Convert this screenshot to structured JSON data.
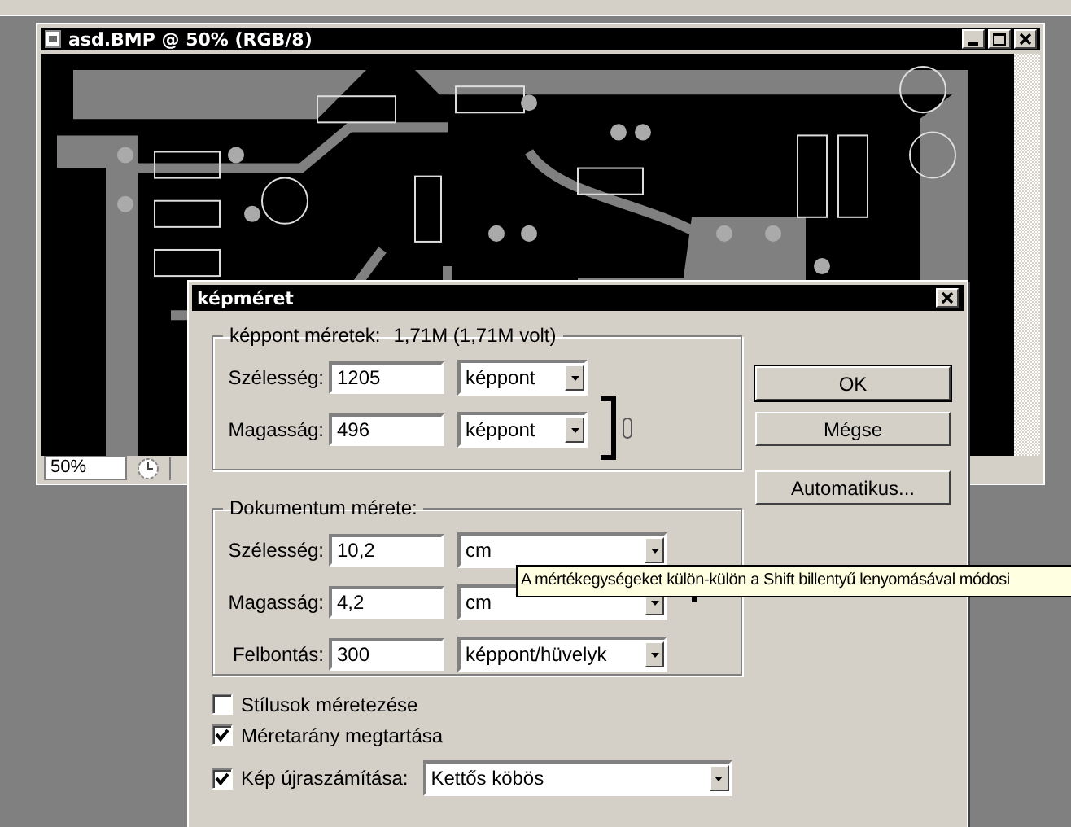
{
  "document": {
    "title": "asd.BMP @ 50% (RGB/8)",
    "zoom": "50%"
  },
  "dialog": {
    "title": "képméret",
    "pixel_group": {
      "label": "képpont méretek:",
      "size": "1,71M (1,71M volt)",
      "fields": [
        {
          "label": "Szélesség:",
          "value": "1205",
          "unit": "képpont"
        },
        {
          "label": "Magasság:",
          "value": "496",
          "unit": "képpont"
        }
      ]
    },
    "document_group": {
      "label": "Dokumentum mérete:",
      "fields": [
        {
          "label": "Szélesség:",
          "value": "10,2",
          "unit": "cm"
        },
        {
          "label": "Magasság:",
          "value": "4,2",
          "unit": "cm"
        },
        {
          "label": "Felbontás:",
          "value": "300",
          "unit": "képpont/hüvelyk"
        }
      ]
    },
    "checkboxes": [
      {
        "label": "Stílusok méretezése",
        "checked": false
      },
      {
        "label": "Méretarány megtartása",
        "checked": true
      }
    ],
    "resample": {
      "label": "Kép újraszámítása:",
      "checked": true,
      "value": "Kettős köbös"
    },
    "buttons": [
      {
        "label": "OK",
        "default": true
      },
      {
        "label": "Mégse",
        "default": false
      },
      {
        "label": "Automatikus...",
        "default": false
      }
    ],
    "tooltip": "A mértékegységeket külön-külön a Shift billentyű lenyomásával módosi"
  }
}
